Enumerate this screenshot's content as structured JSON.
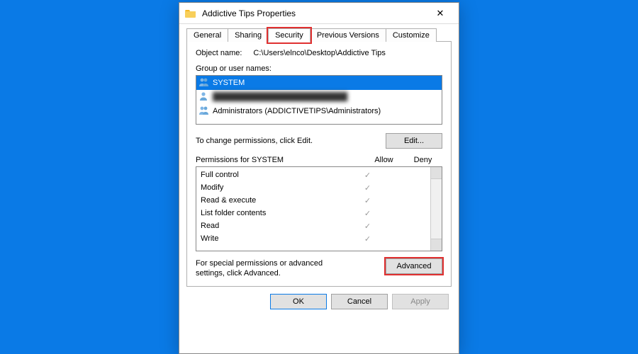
{
  "window": {
    "title": "Addictive Tips Properties"
  },
  "tabs": {
    "items": [
      {
        "label": "General"
      },
      {
        "label": "Sharing"
      },
      {
        "label": "Security",
        "active": true,
        "highlighted": true
      },
      {
        "label": "Previous Versions"
      },
      {
        "label": "Customize"
      }
    ]
  },
  "object": {
    "label": "Object name:",
    "path": "C:\\Users\\elnco\\Desktop\\Addictive Tips"
  },
  "group": {
    "label": "Group or user names:",
    "items": [
      {
        "icon": "group-icon",
        "name": "SYSTEM",
        "selected": true
      },
      {
        "icon": "user-icon",
        "name": "██████████████████████████",
        "obscured": true
      },
      {
        "icon": "group-icon",
        "name": "Administrators (ADDICTIVETIPS\\Administrators)"
      }
    ]
  },
  "edit": {
    "hint": "To change permissions, click Edit.",
    "button": "Edit..."
  },
  "perm": {
    "header_for": "Permissions for SYSTEM",
    "allow_col": "Allow",
    "deny_col": "Deny",
    "rows": [
      {
        "name": "Full control",
        "allow": true,
        "deny": false
      },
      {
        "name": "Modify",
        "allow": true,
        "deny": false
      },
      {
        "name": "Read & execute",
        "allow": true,
        "deny": false
      },
      {
        "name": "List folder contents",
        "allow": true,
        "deny": false
      },
      {
        "name": "Read",
        "allow": true,
        "deny": false
      },
      {
        "name": "Write",
        "allow": true,
        "deny": false
      }
    ]
  },
  "advanced": {
    "hint": "For special permissions or advanced settings, click Advanced.",
    "button": "Advanced",
    "highlighted": true
  },
  "buttons": {
    "ok": "OK",
    "cancel": "Cancel",
    "apply": "Apply"
  },
  "icons": {
    "check": "✓",
    "close": "✕"
  }
}
